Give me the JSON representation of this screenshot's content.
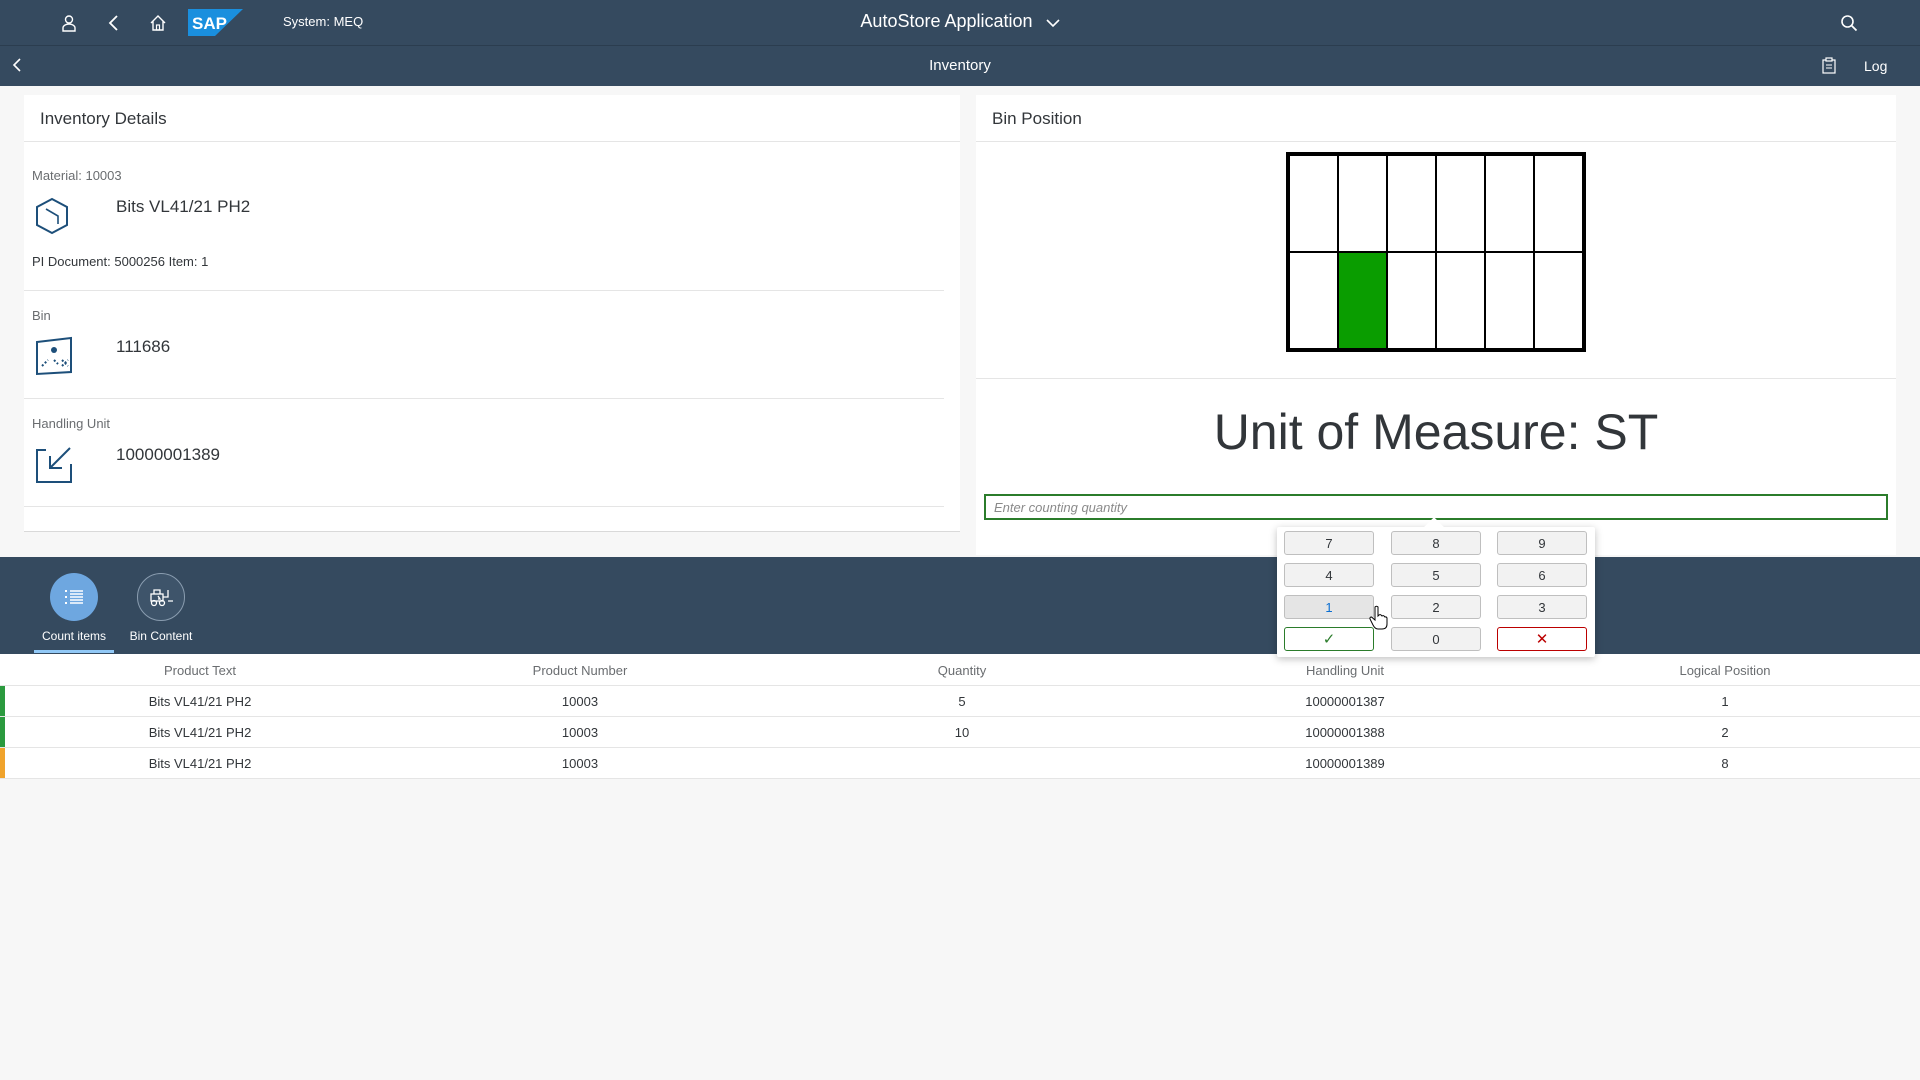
{
  "shell": {
    "system": "System: MEQ",
    "app_title": "AutoStore Application",
    "icons": [
      "user-icon",
      "back-icon",
      "home-icon",
      "sap-logo",
      "search-icon"
    ],
    "logo_text": "SAP"
  },
  "subheader": {
    "title": "Inventory",
    "log": "Log"
  },
  "details": {
    "heading": "Inventory Details",
    "material_label": "Material: 10003",
    "material_name": "Bits VL41/21 PH2",
    "pi_document": "PI Document: 5000256 Item: 1",
    "bin_label": "Bin",
    "bin_value": "111686",
    "hu_label": "Handling Unit",
    "hu_value": "10000001389"
  },
  "bin_position": {
    "heading": "Bin Position",
    "grid_columns": 6,
    "grid_rows": 2,
    "active_cell": {
      "row": 2,
      "col": 2
    },
    "active_color": "#0a9d00"
  },
  "uom": "Unit of Measure: ST",
  "quantity_input": {
    "placeholder": "Enter counting quantity",
    "value": ""
  },
  "keypad": {
    "keys": [
      "7",
      "8",
      "9",
      "4",
      "5",
      "6",
      "1",
      "2",
      "3",
      "✓",
      "0",
      "✕"
    ]
  },
  "tabs": [
    {
      "label": "Count items",
      "selected": true
    },
    {
      "label": "Bin Content",
      "selected": false
    }
  ],
  "table": {
    "columns": [
      "Product Text",
      "Product Number",
      "Quantity",
      "Handling Unit",
      "Logical Position"
    ],
    "rows": [
      {
        "status": "#2b9a3e",
        "product_text": "Bits VL41/21 PH2",
        "product_number": "10003",
        "quantity": "5",
        "handling_unit": "10000001387",
        "logical_position": "1"
      },
      {
        "status": "#2b9a3e",
        "product_text": "Bits VL41/21 PH2",
        "product_number": "10003",
        "quantity": "10",
        "handling_unit": "10000001388",
        "logical_position": "2"
      },
      {
        "status": "#f0a32c",
        "product_text": "Bits VL41/21 PH2",
        "product_number": "10003",
        "quantity": "",
        "handling_unit": "10000001389",
        "logical_position": "8"
      }
    ]
  },
  "colors": {
    "shell": "#354a5f",
    "accent_green": "#2b7c2b",
    "cancel_red": "#bb0000"
  }
}
